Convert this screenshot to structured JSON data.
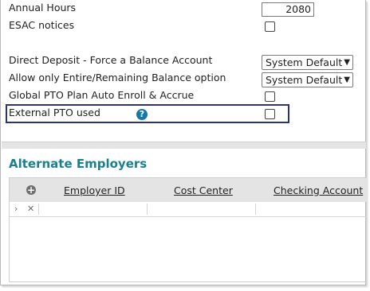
{
  "settings": {
    "annual_hours": {
      "label": "Annual Hours",
      "value": "2080"
    },
    "esac_notices": {
      "label": "ESAC notices",
      "checked": false
    },
    "direct_deposit": {
      "label": "Direct Deposit - Force a Balance Account",
      "selected": "System Default"
    },
    "entire_remaining": {
      "label": "Allow only Entire/Remaining Balance option",
      "selected": "System Default"
    },
    "global_pto": {
      "label": "Global PTO Plan Auto Enroll & Accrue",
      "checked": false
    },
    "external_pto": {
      "label": "External PTO used",
      "checked": false,
      "help_glyph": "?"
    }
  },
  "alternate_employers": {
    "title": "Alternate Employers",
    "columns": [
      "Employer ID",
      "Cost Center",
      "Checking Account"
    ],
    "add_glyph": "+",
    "expand_glyph": "›",
    "delete_glyph": "✕"
  },
  "icons": {
    "dropdown": "chevron-down-icon",
    "help": "help-icon",
    "add": "add-icon",
    "expand": "expand-row-icon",
    "delete": "delete-row-icon"
  },
  "colors": {
    "section_title": "#1a7f91",
    "highlight_border": "#2c3275",
    "help_icon": "#1579a8"
  }
}
